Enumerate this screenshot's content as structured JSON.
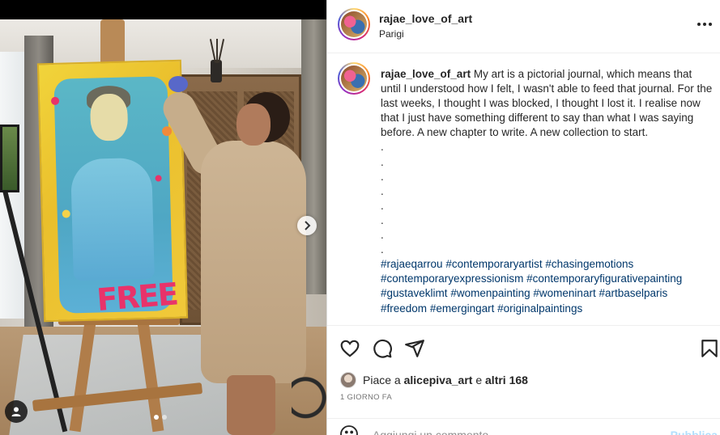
{
  "post": {
    "username": "rajae_love_of_art",
    "location": "Parigi",
    "painting_text": "FREE",
    "caption": {
      "username": "rajae_love_of_art",
      "text": "My art is a pictorial journal, which means that until I understood how I felt, I wasn't able to feed that journal. For the last weeks, I thought I was blocked, I thought I lost it. I realise now that I just have something different to say than what I was saying before. A new chapter to write. A new collection to start.",
      "dots": [
        ".",
        ".",
        ".",
        ".",
        ".",
        ".",
        ".",
        "."
      ],
      "hashtags": [
        "#rajaeqarrou",
        "#contemporaryartist",
        "#chasingemotions",
        "#contemporaryexpressionism",
        "#contemporaryfigurativepainting",
        "#gustaveklimt",
        "#womenpainting",
        "#womeninart",
        "#artbaselparis",
        "#freedom",
        "#emergingart",
        "#originalpaintings"
      ]
    },
    "likes": {
      "prefix": "Piace a",
      "user": "alicepiva_art",
      "middle": "e",
      "others": "altri 168"
    },
    "time_ago": "1 GIORNO FA",
    "comment": {
      "placeholder": "Aggiungi un commento...",
      "post_label": "Pubblica"
    },
    "carousel": {
      "count": 2,
      "active_index": 0
    }
  },
  "icons": {
    "more": "more-horizontal-icon",
    "like": "heart-icon",
    "comment": "comment-icon",
    "share": "share-icon",
    "save": "bookmark-icon",
    "emoji": "emoji-icon",
    "next": "chevron-right-icon",
    "tag": "user-tag-icon"
  },
  "colors": {
    "hashtag": "#00376b",
    "post_button": "#b2dffc",
    "muted": "#737373",
    "text": "#262626"
  }
}
